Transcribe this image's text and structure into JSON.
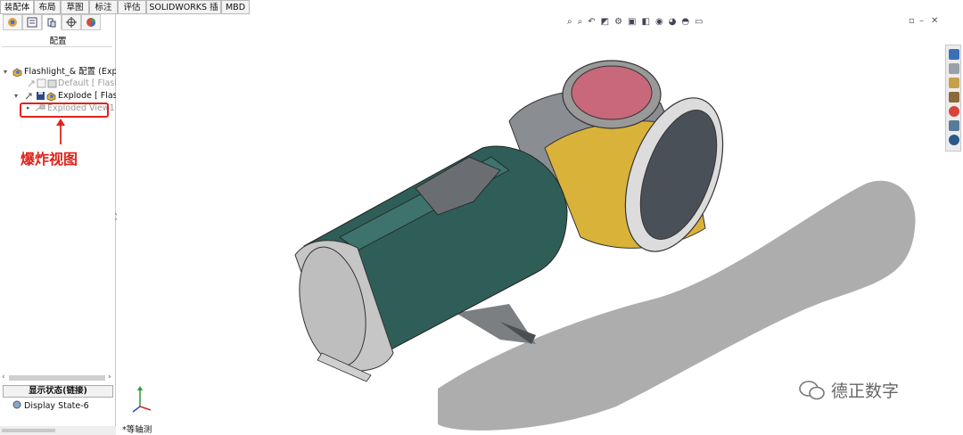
{
  "tabs": [
    {
      "label": "装配体",
      "active": true
    },
    {
      "label": "布局",
      "active": false
    },
    {
      "label": "草图",
      "active": false
    },
    {
      "label": "标注",
      "active": false
    },
    {
      "label": "评估",
      "active": false
    },
    {
      "label": "SOLIDWORKS 插件",
      "active": false
    },
    {
      "label": "MBD",
      "active": false
    }
  ],
  "panel": {
    "title": "配置",
    "tree": [
      {
        "label": "Flashlight_& 配置  (Explode",
        "state": "normal"
      },
      {
        "label": "Default [ Flashlight",
        "state": "gray"
      },
      {
        "label": "Explode [ Flashlight",
        "state": "normal"
      },
      {
        "label": "Exploded View1",
        "state": "gray"
      }
    ],
    "annotation": "爆炸视图",
    "display_state_header": "显示状态(链接)",
    "display_state_item": "Display State-6"
  },
  "viewport": {
    "view_name": "*等轴测",
    "watermark": "德正数字"
  },
  "colors": {
    "body_teal": "#2f5e58",
    "head_yellow": "#d9b23a",
    "lens_pink": "#c8687a",
    "metal_gray": "#8a8e92",
    "annotation_red": "#e0221a"
  }
}
